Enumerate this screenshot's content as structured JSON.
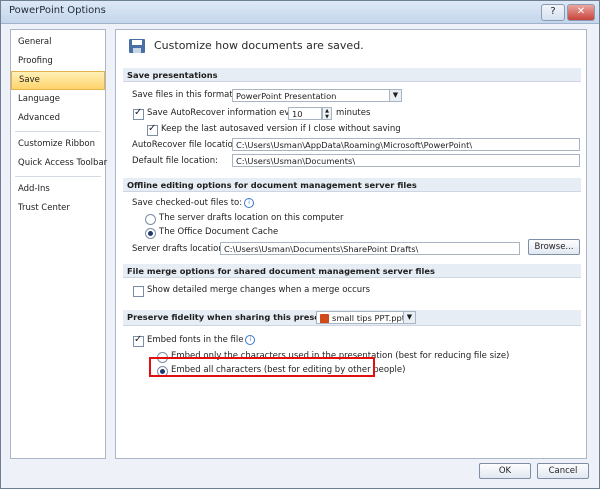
{
  "window": {
    "title": "PowerPoint Options"
  },
  "sidebar": {
    "items": [
      {
        "label": "General"
      },
      {
        "label": "Proofing"
      },
      {
        "label": "Save"
      },
      {
        "label": "Language"
      },
      {
        "label": "Advanced"
      },
      {
        "label": "Customize Ribbon"
      },
      {
        "label": "Quick Access Toolbar"
      },
      {
        "label": "Add-Ins"
      },
      {
        "label": "Trust Center"
      }
    ]
  },
  "header": {
    "title": "Customize how documents are saved."
  },
  "save_presentations": {
    "heading": "Save presentations",
    "format_label": "Save files in this format:",
    "format_value": "PowerPoint Presentation",
    "autorecover_label": "Save AutoRecover information every",
    "autorecover_value": "10",
    "minutes_label": "minutes",
    "keep_label": "Keep the last autosaved version if I close without saving",
    "autorecover_location_label": "AutoRecover file location:",
    "autorecover_location_value": "C:\\Users\\Usman\\AppData\\Roaming\\Microsoft\\PowerPoint\\",
    "default_location_label": "Default file location:",
    "default_location_value": "C:\\Users\\Usman\\Documents\\"
  },
  "offline": {
    "heading": "Offline editing options for document management server files",
    "checked_out_label": "Save checked-out files to:",
    "option_server": "The server drafts location on this computer",
    "option_cache": "The Office Document Cache",
    "server_drafts_label": "Server drafts location:",
    "server_drafts_value": "C:\\Users\\Usman\\Documents\\SharePoint Drafts\\",
    "browse_label": "Browse..."
  },
  "merge": {
    "heading": "File merge options for shared document management server files",
    "show_detailed_label": "Show detailed merge changes when a merge occurs"
  },
  "fidelity": {
    "heading": "Preserve fidelity when sharing this presentation:",
    "file_value": "small tips PPT.pptx",
    "embed_fonts_label": "Embed fonts in the file",
    "embed_used_label": "Embed only the characters used in the presentation (best for reducing file size)",
    "embed_all_label": "Embed all characters (best for editing by other people)"
  },
  "footer": {
    "ok_label": "OK",
    "cancel_label": "Cancel"
  },
  "colors": {
    "highlight": "#e01010",
    "selected_item": "#ffd36b",
    "section_bg": "#e7edf4"
  }
}
